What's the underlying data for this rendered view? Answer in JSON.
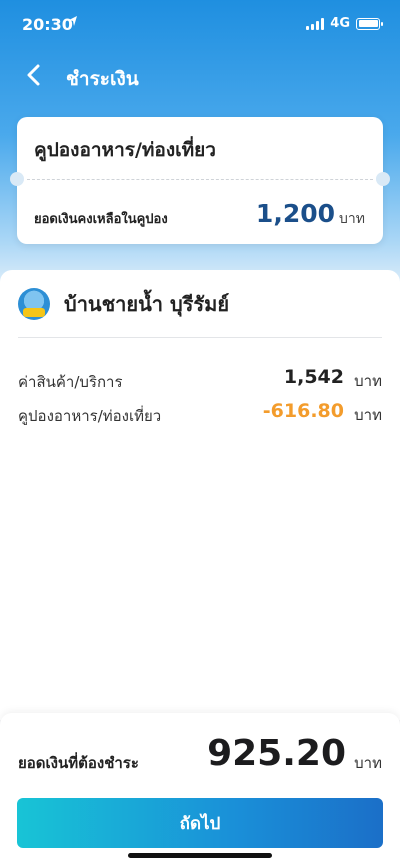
{
  "status_bar": {
    "time": "20:30",
    "network": "4G",
    "icons": [
      "location-arrow-icon",
      "signal-icon",
      "battery-icon"
    ]
  },
  "nav": {
    "title": "ชำระเงิน",
    "back_icon": "chevron-left-icon"
  },
  "coupon": {
    "title": "คูปองอาหาร/ท่องเที่ยว",
    "balance_label": "ยอดเงินคงเหลือในคูปอง",
    "balance_value": "1,200",
    "balance_unit": "บาท"
  },
  "shop": {
    "name": "บ้านชายน้ำ บุรีรัมย์",
    "logo_icon": "shop-logo-icon"
  },
  "items": [
    {
      "label": "ค่าสินค้า/บริการ",
      "value": "1,542",
      "unit": "บาท"
    },
    {
      "label": "คูปองอาหาร/ท่องเที่ยว",
      "value": "-616.80",
      "unit": "บาท"
    }
  ],
  "total": {
    "label": "ยอดเงินที่ต้องชำระ",
    "value": "925.20",
    "unit": "บาท"
  },
  "actions": {
    "next_label": "ถัดไป"
  },
  "colors": {
    "accent_blue": "#1b4f8a",
    "discount_orange": "#f39c2c",
    "button_gradient_start": "#18c4d6",
    "button_gradient_end": "#1b6fc8"
  }
}
